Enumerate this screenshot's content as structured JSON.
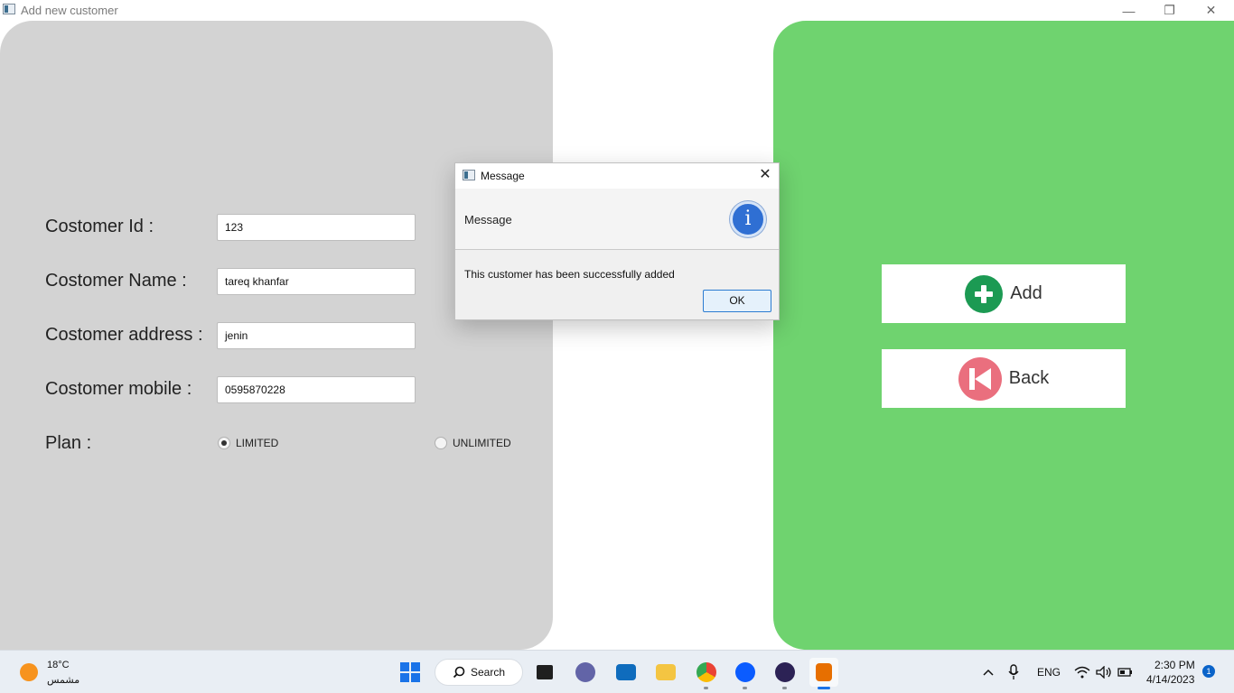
{
  "window": {
    "title": "Add new customer",
    "minimize_glyph": "—",
    "restore_glyph": "❐",
    "close_glyph": "✕"
  },
  "form": {
    "fields": [
      {
        "label": "Costomer Id :",
        "value": "123"
      },
      {
        "label": "Costomer Name :",
        "value": "tareq khanfar"
      },
      {
        "label": "Costomer address :",
        "value": "jenin"
      },
      {
        "label": "Costomer mobile :",
        "value": "0595870228"
      }
    ],
    "plan": {
      "label": "Plan :",
      "options": [
        "LIMITED",
        "UNLIMITED"
      ],
      "selected": "LIMITED"
    }
  },
  "actions": {
    "add_label": "Add",
    "back_label": "Back",
    "add_icon": "plus-circle-icon",
    "back_icon": "skip-back-icon"
  },
  "dialog": {
    "title": "Message",
    "header": "Message",
    "message": "This customer has been successfully added",
    "ok_label": "OK",
    "close_glyph": "✕",
    "icon_glyph": "i"
  },
  "taskbar": {
    "weather_temp": "18°C",
    "weather_condition": "مشمس",
    "search_label": "Search",
    "language": "ENG",
    "time": "2:30 PM",
    "date": "4/14/2023",
    "notification_count": "1"
  },
  "colors": {
    "left_panel": "#d3d3d3",
    "right_panel": "#6fd36f",
    "add_icon": "#1c9a53",
    "back_icon": "#ea6f7e",
    "info_icon": "#2f6fd3"
  }
}
